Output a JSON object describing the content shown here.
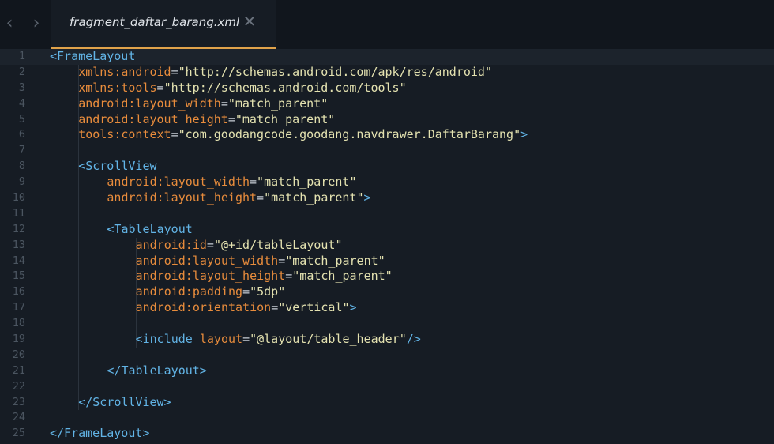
{
  "tab": {
    "back_label": "‹",
    "forward_label": "›",
    "title": "fragment_daftar_barang.xml",
    "close_label": "✕"
  },
  "code_lines": [
    {
      "n": "1",
      "indent": 0,
      "tokens": [
        [
          "tag",
          "<FrameLayout"
        ]
      ]
    },
    {
      "n": "2",
      "indent": 1,
      "tokens": [
        [
          "attr",
          "xmlns:android"
        ],
        [
          "eq",
          "="
        ],
        [
          "val",
          "\"http://schemas.android.com/apk/res/android\""
        ]
      ]
    },
    {
      "n": "3",
      "indent": 1,
      "tokens": [
        [
          "attr",
          "xmlns:tools"
        ],
        [
          "eq",
          "="
        ],
        [
          "val",
          "\"http://schemas.android.com/tools\""
        ]
      ]
    },
    {
      "n": "4",
      "indent": 1,
      "tokens": [
        [
          "attr",
          "android:layout_width"
        ],
        [
          "eq",
          "="
        ],
        [
          "val",
          "\"match_parent\""
        ]
      ]
    },
    {
      "n": "5",
      "indent": 1,
      "tokens": [
        [
          "attr",
          "android:layout_height"
        ],
        [
          "eq",
          "="
        ],
        [
          "val",
          "\"match_parent\""
        ]
      ]
    },
    {
      "n": "6",
      "indent": 1,
      "tokens": [
        [
          "attr",
          "tools:context"
        ],
        [
          "eq",
          "="
        ],
        [
          "val",
          "\"com.goodangcode.goodang.navdrawer.DaftarBarang\""
        ],
        [
          "tag",
          ">"
        ]
      ]
    },
    {
      "n": "7",
      "indent": 0,
      "tokens": []
    },
    {
      "n": "8",
      "indent": 1,
      "tokens": [
        [
          "tag",
          "<ScrollView"
        ]
      ]
    },
    {
      "n": "9",
      "indent": 2,
      "tokens": [
        [
          "attr",
          "android:layout_width"
        ],
        [
          "eq",
          "="
        ],
        [
          "val",
          "\"match_parent\""
        ]
      ]
    },
    {
      "n": "10",
      "indent": 2,
      "tokens": [
        [
          "attr",
          "android:layout_height"
        ],
        [
          "eq",
          "="
        ],
        [
          "val",
          "\"match_parent\""
        ],
        [
          "tag",
          ">"
        ]
      ]
    },
    {
      "n": "11",
      "indent": 0,
      "tokens": []
    },
    {
      "n": "12",
      "indent": 2,
      "tokens": [
        [
          "tag",
          "<TableLayout"
        ]
      ]
    },
    {
      "n": "13",
      "indent": 3,
      "tokens": [
        [
          "attr",
          "android:id"
        ],
        [
          "eq",
          "="
        ],
        [
          "val",
          "\"@+id/tableLayout\""
        ]
      ]
    },
    {
      "n": "14",
      "indent": 3,
      "tokens": [
        [
          "attr",
          "android:layout_width"
        ],
        [
          "eq",
          "="
        ],
        [
          "val",
          "\"match_parent\""
        ]
      ]
    },
    {
      "n": "15",
      "indent": 3,
      "tokens": [
        [
          "attr",
          "android:layout_height"
        ],
        [
          "eq",
          "="
        ],
        [
          "val",
          "\"match_parent\""
        ]
      ]
    },
    {
      "n": "16",
      "indent": 3,
      "tokens": [
        [
          "attr",
          "android:padding"
        ],
        [
          "eq",
          "="
        ],
        [
          "val",
          "\"5dp\""
        ]
      ]
    },
    {
      "n": "17",
      "indent": 3,
      "tokens": [
        [
          "attr",
          "android:orientation"
        ],
        [
          "eq",
          "="
        ],
        [
          "val",
          "\"vertical\""
        ],
        [
          "tag",
          ">"
        ]
      ]
    },
    {
      "n": "18",
      "indent": 0,
      "tokens": []
    },
    {
      "n": "19",
      "indent": 3,
      "tokens": [
        [
          "tag",
          "<include"
        ],
        [
          "eq",
          " "
        ],
        [
          "attr",
          "layout"
        ],
        [
          "eq",
          "="
        ],
        [
          "val",
          "\"@layout/table_header\""
        ],
        [
          "tag",
          "/>"
        ]
      ]
    },
    {
      "n": "20",
      "indent": 0,
      "tokens": []
    },
    {
      "n": "21",
      "indent": 2,
      "tokens": [
        [
          "tag",
          "</TableLayout>"
        ]
      ]
    },
    {
      "n": "22",
      "indent": 0,
      "tokens": []
    },
    {
      "n": "23",
      "indent": 1,
      "tokens": [
        [
          "tag",
          "</ScrollView>"
        ]
      ]
    },
    {
      "n": "24",
      "indent": 0,
      "tokens": []
    },
    {
      "n": "25",
      "indent": 0,
      "tokens": [
        [
          "tag",
          "</FrameLayout>"
        ]
      ]
    }
  ],
  "colors": {
    "background": "#161c24",
    "tag": "#62b4e6",
    "attribute": "#e88c3c",
    "value": "#e4e2b0",
    "line_number": "#4b5560",
    "tab_accent": "#e0a24a"
  }
}
